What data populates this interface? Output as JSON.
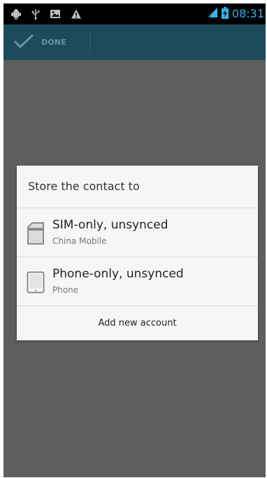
{
  "status_bar": {
    "time": "08:31",
    "icons": [
      "robot-notification-icon",
      "usb-icon",
      "image-notification-icon",
      "warning-icon",
      "signal-icon",
      "battery-charging-icon"
    ],
    "accent_color": "#33b5e5"
  },
  "action_bar": {
    "done_label": "DONE",
    "background": "#1d4b5c"
  },
  "dialog": {
    "title": "Store the contact to",
    "options": [
      {
        "title": "SIM-only, unsynced",
        "subtitle": "China Mobile",
        "icon": "sim-card-icon"
      },
      {
        "title": "Phone-only, unsynced",
        "subtitle": "Phone",
        "icon": "phone-device-icon"
      }
    ],
    "add_account_label": "Add new account"
  },
  "colors": {
    "scrim": "#5e5e5e",
    "dialog_background": "#f6f6f6"
  }
}
